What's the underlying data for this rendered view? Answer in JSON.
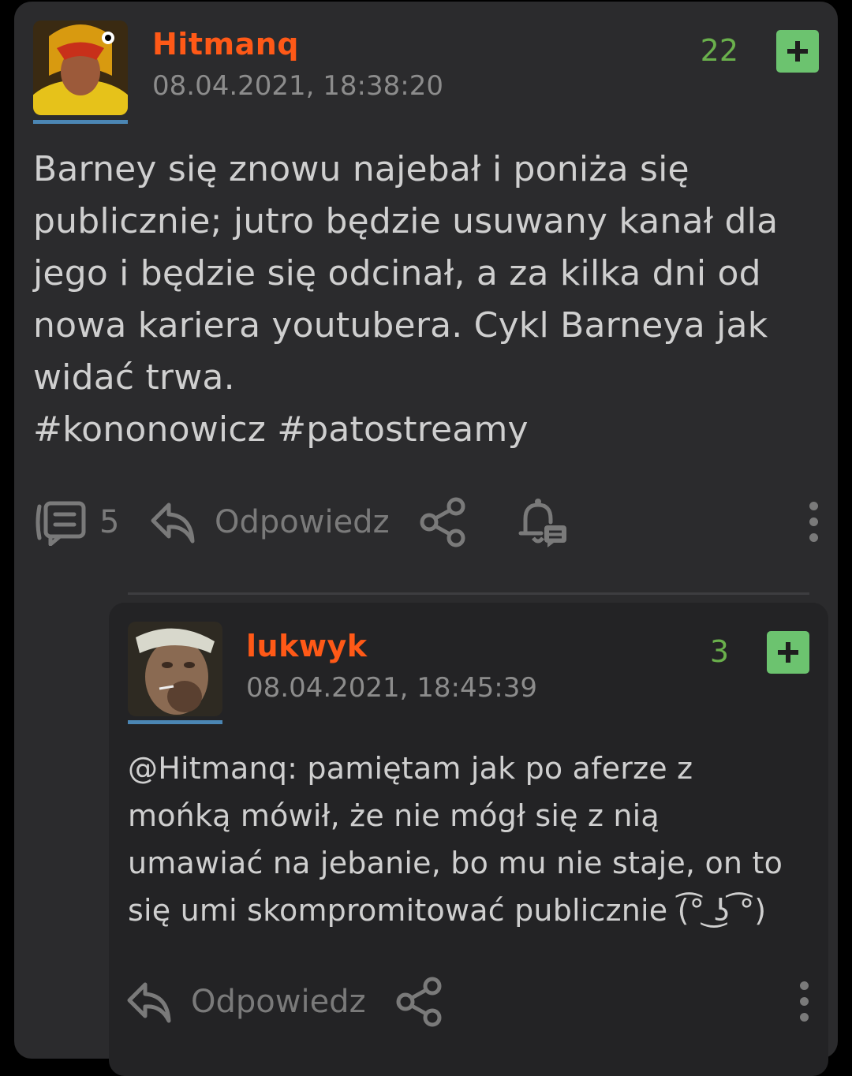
{
  "post": {
    "author": "Hitmanq",
    "timestamp": "08.04.2021, 18:38:20",
    "votes": "22",
    "plus_label": "+",
    "body_lines": [
      "Barney się znowu najebał i poniża się",
      "publicznie; jutro będzie usuwany kanał dla",
      "jego i będzie się odcinał, a za kilka dni od",
      "nowa kariera youtubera. Cykl Barneya jak",
      "widać trwa.",
      "#kononowicz #patostreamy"
    ],
    "comment_count": "5",
    "reply_label": "Odpowiedz"
  },
  "comment": {
    "author": "lukwyk",
    "timestamp": "08.04.2021, 18:45:39",
    "votes": "3",
    "plus_label": "+",
    "mention": "@Hitmanq",
    "body_lines": [
      ": pamiętam jak po aferze z",
      "mońką mówił, że nie mógł się z nią",
      "umawiać na jebanie, bo mu nie staje, on to",
      "się umi skompromitować publicznie (͡° ͜ʖ ͡°)"
    ],
    "reply_label": "Odpowiedz"
  },
  "colors": {
    "username": "#ff5917",
    "votes": "#6ab04c",
    "plus_button": "#6cc36f",
    "avatar_underline": "#4b86b4"
  }
}
